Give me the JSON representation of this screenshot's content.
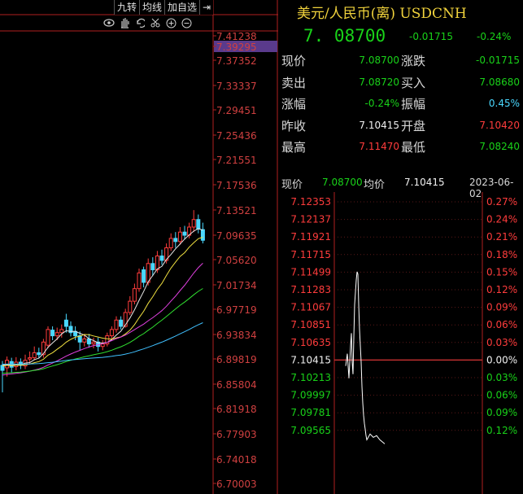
{
  "toolbar": {
    "buttons": [
      "九转",
      "均线",
      "加自选",
      "⇥"
    ],
    "icons": [
      "eye-icon",
      "hand-icon",
      "undo-icon",
      "scissors-icon",
      "zoom-in-icon",
      "zoom-out-icon"
    ]
  },
  "kline_axis": {
    "labels": [
      "7.41238",
      "7.39295",
      "7.37352",
      "7.33337",
      "7.29451",
      "7.25436",
      "7.21551",
      "7.17536",
      "7.13521",
      "7.09635",
      "7.05620",
      "7.01734",
      "6.97719",
      "6.93834",
      "6.89819",
      "6.85804",
      "6.81918",
      "6.77903",
      "6.74018",
      "6.70003"
    ],
    "highlight": "7.39295"
  },
  "quote": {
    "title": "美元/人民币(离) USDCNH",
    "price": "7. 08700",
    "change": "-0.01715",
    "change_pct": "-0.24%",
    "rows": [
      {
        "l1": "现价",
        "v1": "7.08700",
        "c1": "green",
        "l2": "涨跌",
        "v2": "-0.01715",
        "c2": "green"
      },
      {
        "l1": "卖出",
        "v1": "7.08720",
        "c1": "green",
        "l2": "买入",
        "v2": "7.08680",
        "c2": "green"
      },
      {
        "l1": "涨幅",
        "v1": "-0.24%",
        "c1": "green",
        "l2": "振幅",
        "v2": "0.45%",
        "c2": "cyan"
      },
      {
        "l1": "昨收",
        "v1": "7.10415",
        "c1": "white",
        "l2": "开盘",
        "v2": "7.10420",
        "c2": "red"
      },
      {
        "l1": "最高",
        "v1": "7.11470",
        "c1": "red",
        "l2": "最低",
        "v2": "7.08240",
        "c2": "green"
      }
    ]
  },
  "tick": {
    "price_label": "现价",
    "price": "7.08700",
    "avg_label": "均价",
    "avg": "7.10415",
    "date": "2023-06-02"
  },
  "intraday_axis": {
    "left": [
      "7.12353",
      "7.12137",
      "7.11921",
      "7.11715",
      "7.11499",
      "7.11283",
      "7.11067",
      "7.10851",
      "7.10635",
      "7.10415",
      "7.10213",
      "7.09997",
      "7.09781",
      "7.09565"
    ],
    "right": [
      "0.27%",
      "0.24%",
      "0.21%",
      "0.18%",
      "0.15%",
      "0.12%",
      "0.09%",
      "0.06%",
      "0.03%",
      "0.00%",
      "0.03%",
      "0.06%",
      "0.09%",
      "0.12%"
    ],
    "base_index": 9
  },
  "colors": {
    "red": "#d04040",
    "green": "#19d219",
    "yellow": "#f0d23c"
  }
}
